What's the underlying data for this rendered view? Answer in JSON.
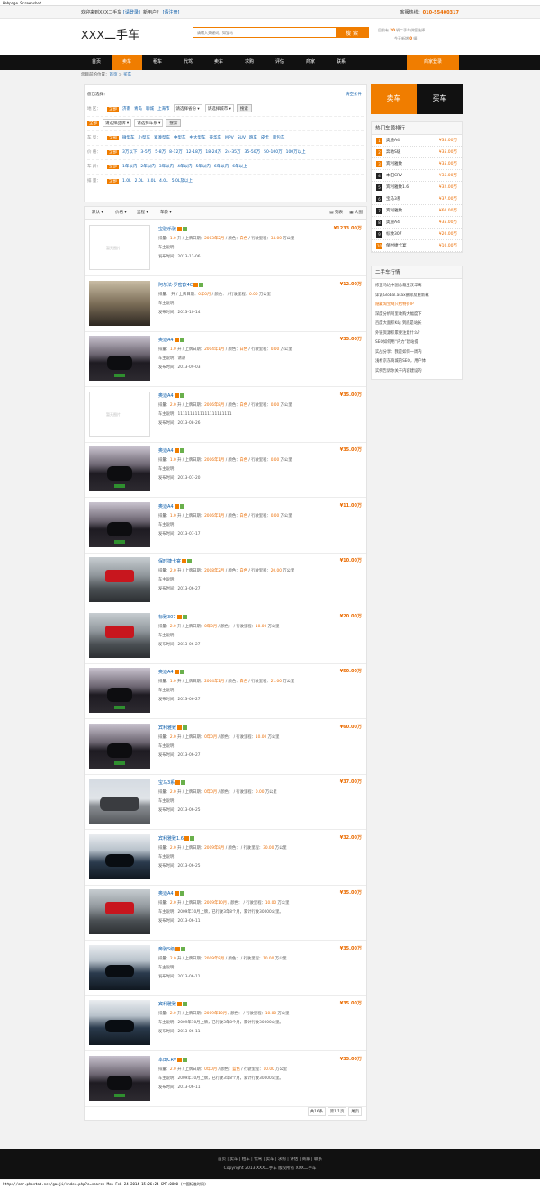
{
  "screenshot_title": "Webpage Screenshot",
  "topbar": {
    "welcome": "欢迎来到XXX二手车",
    "login": "[请登录]",
    "new_user": "新用户？",
    "register": "[请注册]",
    "hotline_label": "客服热线：",
    "hotline": "010-55400317"
  },
  "header": {
    "logo": "XXX二手车",
    "search_placeholder": "请输入关键词，如宝马",
    "search_button": "搜 索",
    "stat1_a": "目前有",
    "stat1_n": "20",
    "stat1_b": "辆二手车供您选择",
    "stat2_a": "今天新增",
    "stat2_n": "0",
    "stat2_b": "辆"
  },
  "nav": {
    "items": [
      "首页",
      "卖车",
      "租车",
      "代驾",
      "卖车",
      "求购",
      "评估",
      "商家",
      "联系"
    ],
    "login": "商家登录"
  },
  "breadcrumb": {
    "prefix": "您目前的位置：",
    "home": "首页",
    "sep": " > ",
    "current": "买车"
  },
  "filter": {
    "selected_label": "您已选择：",
    "clear": "清空条件",
    "region": {
      "label": "地 区：",
      "all": "全部",
      "options": [
        "济南",
        "青岛",
        "聊城",
        "上海市"
      ],
      "province": "请选择省份",
      "city": "请选择城市",
      "btn": "搜索"
    },
    "brand": {
      "all": "全部",
      "brand_select": "请选择品牌",
      "series_select": "请选择车系",
      "btn": "搜索"
    },
    "type": {
      "label": "车 型：",
      "all": "全部",
      "options": [
        "微型车",
        "小型车",
        "紧凑型车",
        "中型车",
        "中大型车",
        "豪华车",
        "MPV",
        "SUV",
        "跑车",
        "皮卡",
        "面包车"
      ]
    },
    "price": {
      "label": "价 格：",
      "all": "全部",
      "options": [
        "3万以下",
        "3-5万",
        "5-8万",
        "8-12万",
        "12-18万",
        "18-24万",
        "24-35万",
        "35-50万",
        "50-100万",
        "100万以上"
      ]
    },
    "age": {
      "label": "车 龄：",
      "all": "全部",
      "options": [
        "1年以内",
        "2年以内",
        "3年以内",
        "4年以内",
        "5年以内",
        "6年以内",
        "6年以上"
      ]
    },
    "displacement": {
      "label": "排 量：",
      "all": "全部",
      "options": [
        "1.0L",
        "2.0L",
        "3.0L",
        "4.0L",
        "5.0L及以上"
      ]
    }
  },
  "sort": {
    "default": "默认",
    "price": "价格",
    "mileage": "里程",
    "year": "车龄",
    "list": "列表",
    "big": "大图"
  },
  "labels": {
    "disp": "排量：",
    "disp_unit": " 升",
    "reg": " / 上牌日期：",
    "color": " / 颜色：",
    "mile": " / 行驶里程：",
    "mile_unit": " 万公里",
    "desc": "车主说明：",
    "pub": "发布时间："
  },
  "cars": [
    {
      "name": "宝骏乐驰",
      "disp": "1.0",
      "reg": "2003年2月",
      "color": "白色",
      "mile": "34.00",
      "desc": "",
      "pub": "2013-11-06",
      "price": "¥1233.00万",
      "img": "empty"
    },
    {
      "name": "阿尔法·罗密欧4C",
      "disp": "",
      "reg": "0年0月",
      "color": "",
      "mile": "0.00",
      "desc": "",
      "pub": "2013-10-14",
      "price": "¥12.00万",
      "img": "dusk"
    },
    {
      "name": "奥迪A4",
      "disp": "1.0",
      "reg": "2004年1月",
      "color": "白色",
      "mile": "0.00",
      "desc": "请讲",
      "pub": "2013-09-03",
      "price": "¥35.00万",
      "img": "dark"
    },
    {
      "name": "奥迪A4",
      "disp": "2.0",
      "reg": "2006年8月",
      "color": "白色",
      "mile": "0.00",
      "desc": "1111111111111111111111",
      "pub": "2013-08-26",
      "price": "¥35.00万",
      "img": "empty"
    },
    {
      "name": "奥迪A4",
      "disp": "1.0",
      "reg": "2006年1月",
      "color": "白色",
      "mile": "0.00",
      "desc": "",
      "pub": "2013-07-20",
      "price": "¥35.00万",
      "img": "dark"
    },
    {
      "name": "奥迪A4",
      "disp": "1.0",
      "reg": "2006年1月",
      "color": "白色",
      "mile": "0.00",
      "desc": "",
      "pub": "2013-07-17",
      "price": "¥11.00万",
      "img": "dark"
    },
    {
      "name": "保时捷卡宴",
      "disp": "2.0",
      "reg": "2008年2月",
      "color": "白色",
      "mile": "20.00",
      "desc": "",
      "pub": "2013-06-27",
      "price": "¥10.00万",
      "img": "gray"
    },
    {
      "name": "标致307",
      "disp": "2.0",
      "reg": "0年0月",
      "color": "",
      "mile": "10.00",
      "desc": "",
      "pub": "2013-06-27",
      "price": "¥20.00万",
      "img": "gray"
    },
    {
      "name": "奥迪A4",
      "disp": "1.0",
      "reg": "2004年1月",
      "color": "白色",
      "mile": "21.00",
      "desc": "",
      "pub": "2013-06-27",
      "price": "¥50.00万",
      "img": "dark"
    },
    {
      "name": "宾利雅致",
      "disp": "2.0",
      "reg": "0年0月",
      "color": "",
      "mile": "10.00",
      "desc": "",
      "pub": "2013-06-27",
      "price": "¥60.00万",
      "img": "dark"
    },
    {
      "name": "宝马3系",
      "disp": "2.0",
      "reg": "0年0月",
      "color": "",
      "mile": "0.00",
      "desc": "",
      "pub": "2013-06-25",
      "price": "¥37.00万",
      "img": "road"
    },
    {
      "name": "宾利雅致1.6",
      "disp": "2.0",
      "reg": "2009年8月",
      "color": "",
      "mile": "30.00",
      "desc": "",
      "pub": "2013-06-25",
      "price": "¥32.00万",
      "img": "show"
    },
    {
      "name": "奥迪A4",
      "disp": "2.0",
      "reg": "2009年10月",
      "color": "",
      "mile": "10.00",
      "desc": "2009年10月上牌，已行驶3年8个月，累计行驶30000公里。",
      "pub": "2013-06-11",
      "price": "¥35.00万",
      "img": "gray"
    },
    {
      "name": "奔驰S级",
      "disp": "2.0",
      "reg": "2009年8月",
      "color": "",
      "mile": "10.00",
      "desc": "",
      "pub": "2013-06-11",
      "price": "¥35.00万",
      "img": "show"
    },
    {
      "name": "宾利雅致",
      "disp": "2.0",
      "reg": "2009年10月",
      "color": "",
      "mile": "10.00",
      "desc": "2009年10月上牌，已行驶3年8个月，累计行驶30000公里。",
      "pub": "2013-06-11",
      "price": "¥35.00万",
      "img": "show"
    },
    {
      "name": "本田CRV",
      "disp": "2.0",
      "reg": "0年0月",
      "color": "蓝色",
      "mile": "10.00",
      "desc": "2009年10月上牌，已行驶3年8个月，累计行驶30000公里。",
      "pub": "2013-06-11",
      "price": "¥35.00万",
      "img": "dark"
    }
  ],
  "pager": {
    "total": "共16条",
    "page": "第1/1页",
    "last": "尾页"
  },
  "side": {
    "sell_tab": "卖车",
    "buy_tab": "买车",
    "rank_title": "热门车源排行",
    "rank": [
      {
        "n": "1",
        "name": "奥迪A4",
        "price": "¥35.00万"
      },
      {
        "n": "2",
        "name": "奔驰S级",
        "price": "¥35.00万"
      },
      {
        "n": "3",
        "name": "宾利雅致",
        "price": "¥35.00万"
      },
      {
        "n": "4",
        "name": "本田CRV",
        "price": "¥35.00万"
      },
      {
        "n": "5",
        "name": "宾利雅致1.6",
        "price": "¥32.00万"
      },
      {
        "n": "6",
        "name": "宝马3系",
        "price": "¥37.00万"
      },
      {
        "n": "7",
        "name": "宾利雅致",
        "price": "¥60.00万"
      },
      {
        "n": "8",
        "name": "奥迪A4",
        "price": "¥35.00万"
      },
      {
        "n": "9",
        "name": "标致307",
        "price": "¥20.00万"
      },
      {
        "n": "10",
        "name": "保时捷卡宴",
        "price": "¥10.00万"
      }
    ],
    "news_title": "二手车行情",
    "news": [
      "修正马达中国总裁王汉华离",
      "详说Global.asax删除及重新载",
      "隐藏淘宝网只给特价IP",
      "深度分析阿里收购大幅度下",
      "百度大面积K站 到底是站长",
      "外链资源积累要注意什么？",
      "SEO如何用“内力”建站提",
      "实战分享：我是如何一周内",
      "浅析京东商城的SEO，用户体",
      "实例告诉你关于内容建设的"
    ]
  },
  "footer": {
    "links": "首页 | 卖车 | 租车 | 代驾 | 卖车 | 求购 | 评估 | 商家 | 联系",
    "copyright": "Copyright 2013 XXX二手车 版权所有 XXX二手车"
  },
  "bottom_url": "http://car.phpstat.net/gaoji/index.php?c=search Mon Feb 24 2014 15:26:24 GMT+0800 (中国标准时间)",
  "colors": {
    "accent": "#f07d00",
    "nav_bg": "#111111",
    "link": "#0a5ba8"
  }
}
